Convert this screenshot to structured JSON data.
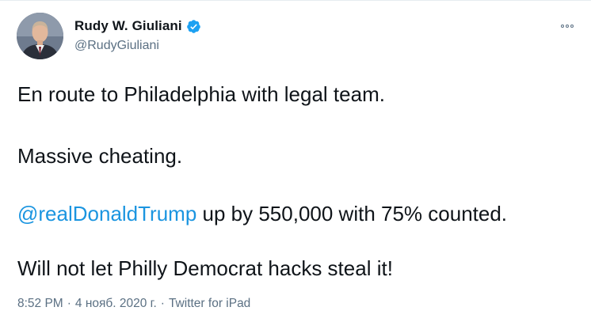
{
  "author": {
    "display_name": "Rudy W. Giuliani",
    "handle": "@RudyGiuliani",
    "verified": true
  },
  "tweet": {
    "line1": "En route to Philadelphia with legal team.",
    "line2": "Massive cheating.",
    "mention": "@realDonaldTrump",
    "line3_rest": " up by 550,000 with 75% counted.",
    "line4": "Will not let Philly Democrat hacks steal it!"
  },
  "meta": {
    "time": "8:52 PM",
    "separator": "·",
    "date": "4 нояб. 2020 г.",
    "source": "Twitter for iPad"
  },
  "icons": {
    "verified": "verified-badge-icon",
    "more": "more-options-icon"
  },
  "colors": {
    "link": "#1b95e0",
    "verified": "#1da1f2",
    "secondary_text": "#5b7083",
    "primary_text": "#0f1419"
  }
}
